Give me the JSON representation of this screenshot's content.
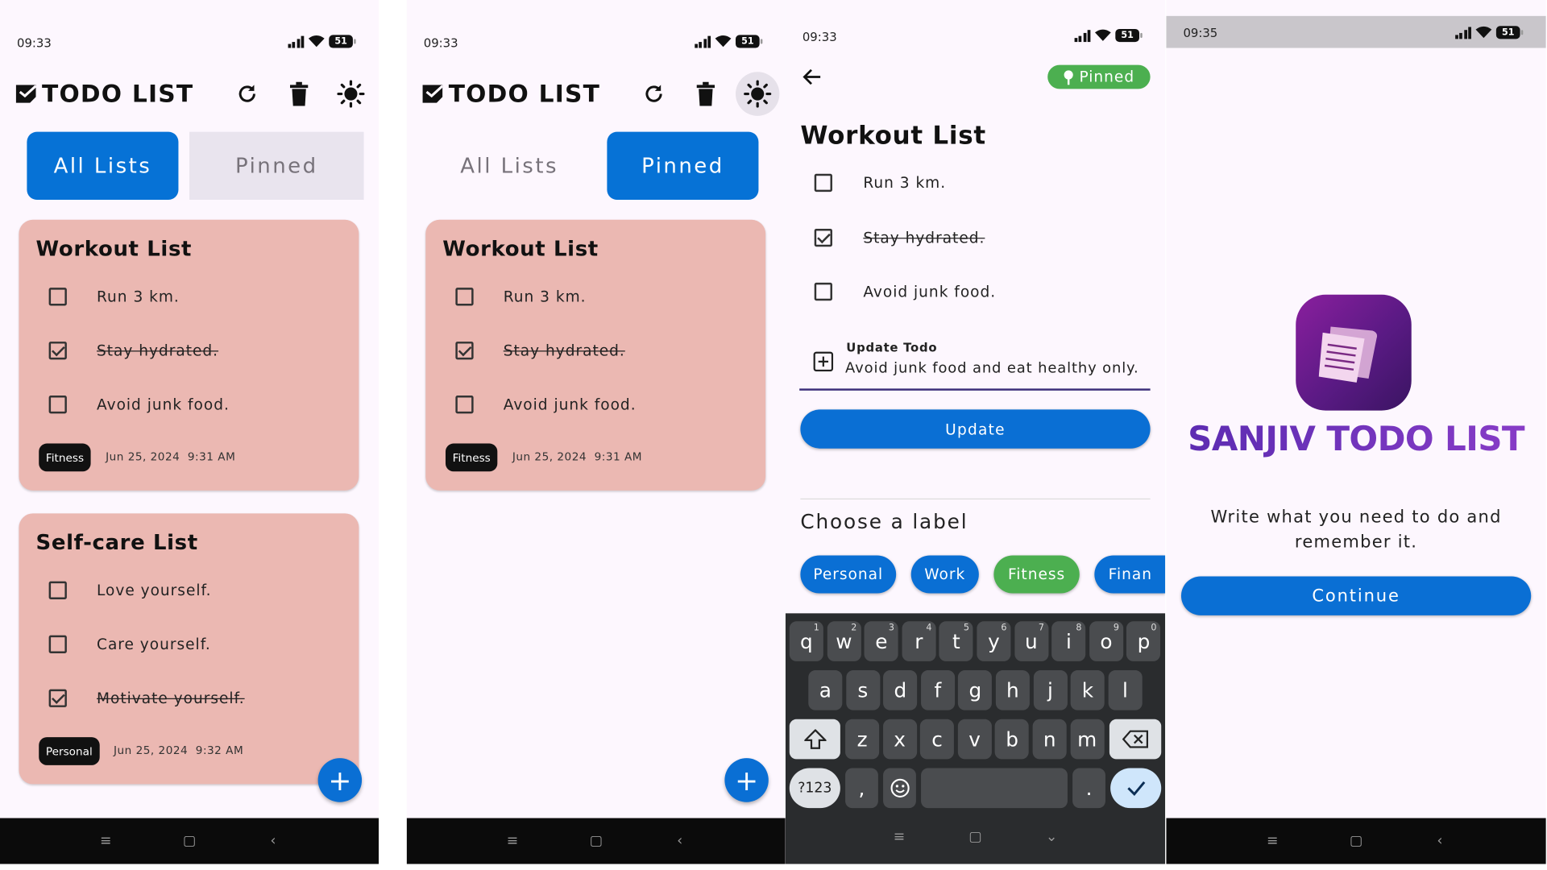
{
  "screen1": {
    "time": "09:33",
    "battery": "51",
    "app_title": "TODO LIST",
    "tabs": {
      "all": "All Lists",
      "pinned": "Pinned"
    },
    "cards": [
      {
        "title": "Workout List",
        "todos": [
          {
            "text": "Run 3 km.",
            "done": false
          },
          {
            "text": "Stay hydrated.",
            "done": true
          },
          {
            "text": "Avoid junk food.",
            "done": false
          }
        ],
        "label": "Fitness",
        "date": "Jun 25, 2024",
        "time": "9:31 AM"
      },
      {
        "title": "Self-care List",
        "todos": [
          {
            "text": "Love yourself.",
            "done": false
          },
          {
            "text": "Care yourself.",
            "done": false
          },
          {
            "text": "Motivate yourself.",
            "done": true
          }
        ],
        "label": "Personal",
        "date": "Jun 25, 2024",
        "time": "9:32 AM"
      }
    ],
    "fab": "+"
  },
  "screen2": {
    "time": "09:33",
    "battery": "51",
    "app_title": "TODO LIST",
    "tabs": {
      "all": "All Lists",
      "pinned": "Pinned"
    },
    "card": {
      "title": "Workout List",
      "todos": [
        {
          "text": "Run 3 km.",
          "done": false
        },
        {
          "text": "Stay hydrated.",
          "done": true
        },
        {
          "text": "Avoid junk food.",
          "done": false
        }
      ],
      "label": "Fitness",
      "date": "Jun 25, 2024",
      "time": "9:31 AM"
    },
    "fab": "+"
  },
  "screen3": {
    "time": "09:33",
    "battery": "51",
    "pinned_badge": "Pinned",
    "title": "Workout List",
    "todos": [
      {
        "text": "Run 3 km.",
        "done": false
      },
      {
        "text": "Stay hydrated.",
        "done": true
      },
      {
        "text": "Avoid junk food.",
        "done": false
      }
    ],
    "input_label": "Update Todo",
    "input_value": "Avoid junk food and eat healthy only.",
    "update_button": "Update",
    "choose_label": "Choose a label",
    "labels": [
      {
        "text": "Personal",
        "color": "#0a6fd4"
      },
      {
        "text": "Work",
        "color": "#0a6fd4"
      },
      {
        "text": "Fitness",
        "color": "#4caf50"
      },
      {
        "text": "Finan",
        "color": "#0a6fd4"
      }
    ],
    "keyboard": {
      "row1": [
        {
          "k": "q",
          "n": "1"
        },
        {
          "k": "w",
          "n": "2"
        },
        {
          "k": "e",
          "n": "3"
        },
        {
          "k": "r",
          "n": "4"
        },
        {
          "k": "t",
          "n": "5"
        },
        {
          "k": "y",
          "n": "6"
        },
        {
          "k": "u",
          "n": "7"
        },
        {
          "k": "i",
          "n": "8"
        },
        {
          "k": "o",
          "n": "9"
        },
        {
          "k": "p",
          "n": "0"
        }
      ],
      "row2": [
        "a",
        "s",
        "d",
        "f",
        "g",
        "h",
        "j",
        "k",
        "l"
      ],
      "row3": [
        "z",
        "x",
        "c",
        "v",
        "b",
        "n",
        "m"
      ],
      "sym": "?123",
      "comma": ",",
      "period": "."
    }
  },
  "screen4": {
    "time": "09:35",
    "battery": "51",
    "brand": "SANJIV TODO LIST",
    "tagline": "Write what you need to do and remember it.",
    "continue": "Continue"
  },
  "colors": {
    "primary": "#0672d6",
    "card": "#ebb8b2",
    "fitness": "#4caf50",
    "brand_start": "#4a1a8a",
    "brand_end": "#c21d8a"
  }
}
